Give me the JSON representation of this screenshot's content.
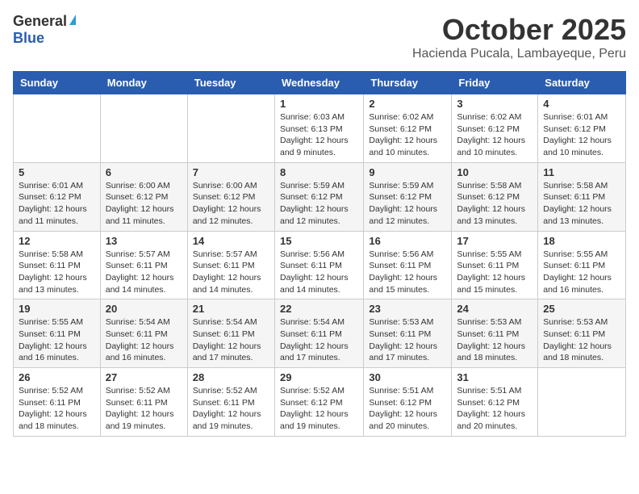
{
  "header": {
    "logo_general": "General",
    "logo_blue": "Blue",
    "month": "October 2025",
    "location": "Hacienda Pucala, Lambayeque, Peru"
  },
  "days_of_week": [
    "Sunday",
    "Monday",
    "Tuesday",
    "Wednesday",
    "Thursday",
    "Friday",
    "Saturday"
  ],
  "weeks": [
    [
      {
        "day": "",
        "info": ""
      },
      {
        "day": "",
        "info": ""
      },
      {
        "day": "",
        "info": ""
      },
      {
        "day": "1",
        "info": "Sunrise: 6:03 AM\nSunset: 6:13 PM\nDaylight: 12 hours\nand 9 minutes."
      },
      {
        "day": "2",
        "info": "Sunrise: 6:02 AM\nSunset: 6:12 PM\nDaylight: 12 hours\nand 10 minutes."
      },
      {
        "day": "3",
        "info": "Sunrise: 6:02 AM\nSunset: 6:12 PM\nDaylight: 12 hours\nand 10 minutes."
      },
      {
        "day": "4",
        "info": "Sunrise: 6:01 AM\nSunset: 6:12 PM\nDaylight: 12 hours\nand 10 minutes."
      }
    ],
    [
      {
        "day": "5",
        "info": "Sunrise: 6:01 AM\nSunset: 6:12 PM\nDaylight: 12 hours\nand 11 minutes."
      },
      {
        "day": "6",
        "info": "Sunrise: 6:00 AM\nSunset: 6:12 PM\nDaylight: 12 hours\nand 11 minutes."
      },
      {
        "day": "7",
        "info": "Sunrise: 6:00 AM\nSunset: 6:12 PM\nDaylight: 12 hours\nand 12 minutes."
      },
      {
        "day": "8",
        "info": "Sunrise: 5:59 AM\nSunset: 6:12 PM\nDaylight: 12 hours\nand 12 minutes."
      },
      {
        "day": "9",
        "info": "Sunrise: 5:59 AM\nSunset: 6:12 PM\nDaylight: 12 hours\nand 12 minutes."
      },
      {
        "day": "10",
        "info": "Sunrise: 5:58 AM\nSunset: 6:12 PM\nDaylight: 12 hours\nand 13 minutes."
      },
      {
        "day": "11",
        "info": "Sunrise: 5:58 AM\nSunset: 6:11 PM\nDaylight: 12 hours\nand 13 minutes."
      }
    ],
    [
      {
        "day": "12",
        "info": "Sunrise: 5:58 AM\nSunset: 6:11 PM\nDaylight: 12 hours\nand 13 minutes."
      },
      {
        "day": "13",
        "info": "Sunrise: 5:57 AM\nSunset: 6:11 PM\nDaylight: 12 hours\nand 14 minutes."
      },
      {
        "day": "14",
        "info": "Sunrise: 5:57 AM\nSunset: 6:11 PM\nDaylight: 12 hours\nand 14 minutes."
      },
      {
        "day": "15",
        "info": "Sunrise: 5:56 AM\nSunset: 6:11 PM\nDaylight: 12 hours\nand 14 minutes."
      },
      {
        "day": "16",
        "info": "Sunrise: 5:56 AM\nSunset: 6:11 PM\nDaylight: 12 hours\nand 15 minutes."
      },
      {
        "day": "17",
        "info": "Sunrise: 5:55 AM\nSunset: 6:11 PM\nDaylight: 12 hours\nand 15 minutes."
      },
      {
        "day": "18",
        "info": "Sunrise: 5:55 AM\nSunset: 6:11 PM\nDaylight: 12 hours\nand 16 minutes."
      }
    ],
    [
      {
        "day": "19",
        "info": "Sunrise: 5:55 AM\nSunset: 6:11 PM\nDaylight: 12 hours\nand 16 minutes."
      },
      {
        "day": "20",
        "info": "Sunrise: 5:54 AM\nSunset: 6:11 PM\nDaylight: 12 hours\nand 16 minutes."
      },
      {
        "day": "21",
        "info": "Sunrise: 5:54 AM\nSunset: 6:11 PM\nDaylight: 12 hours\nand 17 minutes."
      },
      {
        "day": "22",
        "info": "Sunrise: 5:54 AM\nSunset: 6:11 PM\nDaylight: 12 hours\nand 17 minutes."
      },
      {
        "day": "23",
        "info": "Sunrise: 5:53 AM\nSunset: 6:11 PM\nDaylight: 12 hours\nand 17 minutes."
      },
      {
        "day": "24",
        "info": "Sunrise: 5:53 AM\nSunset: 6:11 PM\nDaylight: 12 hours\nand 18 minutes."
      },
      {
        "day": "25",
        "info": "Sunrise: 5:53 AM\nSunset: 6:11 PM\nDaylight: 12 hours\nand 18 minutes."
      }
    ],
    [
      {
        "day": "26",
        "info": "Sunrise: 5:52 AM\nSunset: 6:11 PM\nDaylight: 12 hours\nand 18 minutes."
      },
      {
        "day": "27",
        "info": "Sunrise: 5:52 AM\nSunset: 6:11 PM\nDaylight: 12 hours\nand 19 minutes."
      },
      {
        "day": "28",
        "info": "Sunrise: 5:52 AM\nSunset: 6:11 PM\nDaylight: 12 hours\nand 19 minutes."
      },
      {
        "day": "29",
        "info": "Sunrise: 5:52 AM\nSunset: 6:12 PM\nDaylight: 12 hours\nand 19 minutes."
      },
      {
        "day": "30",
        "info": "Sunrise: 5:51 AM\nSunset: 6:12 PM\nDaylight: 12 hours\nand 20 minutes."
      },
      {
        "day": "31",
        "info": "Sunrise: 5:51 AM\nSunset: 6:12 PM\nDaylight: 12 hours\nand 20 minutes."
      },
      {
        "day": "",
        "info": ""
      }
    ]
  ]
}
